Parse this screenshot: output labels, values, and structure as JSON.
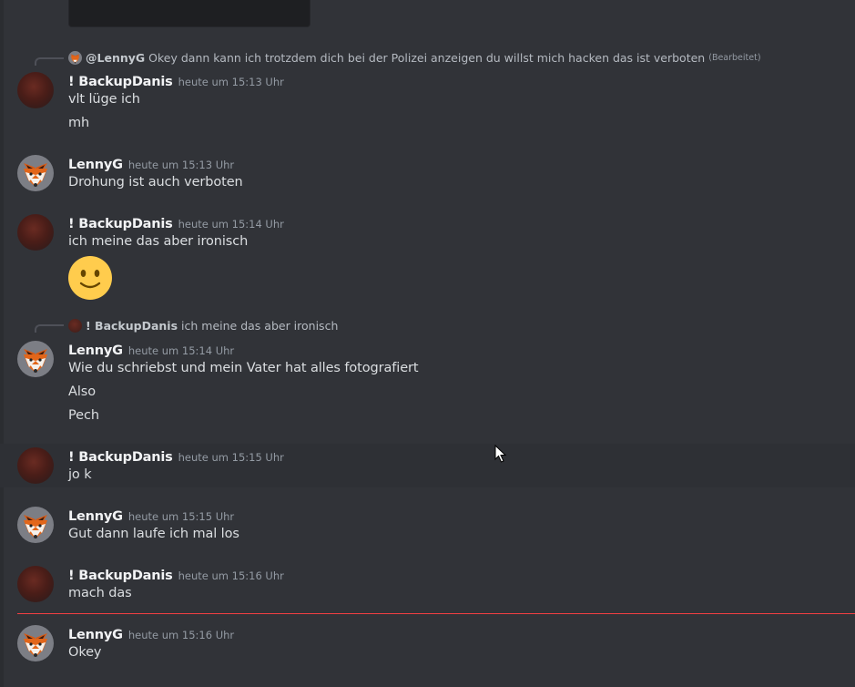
{
  "messages": {
    "m1": {
      "reply_to_name": "@LennyG",
      "reply_to_text": "Okey dann kann ich trotzdem dich bei der Polizei anzeigen du willst mich hacken das ist verboten",
      "reply_edited": "(Bearbeitet)",
      "author": "! BackupDanis",
      "time": "heute um 15:13 Uhr",
      "lines": [
        "vlt lüge ich",
        "mh"
      ]
    },
    "m2": {
      "author": "LennyG",
      "time": "heute um 15:13 Uhr",
      "lines": [
        "Drohung ist auch verboten"
      ]
    },
    "m3": {
      "author": "! BackupDanis",
      "time": "heute um 15:14 Uhr",
      "lines": [
        "ich meine das aber ironisch"
      ],
      "emoji": "slightly-smiling-face"
    },
    "m4": {
      "reply_to_name": "! BackupDanis",
      "reply_to_text": "ich meine das aber ironisch",
      "author": "LennyG",
      "time": "heute um 15:14 Uhr",
      "lines": [
        "Wie du schriebst und mein Vater hat alles fotografiert",
        "Also",
        "Pech"
      ]
    },
    "m5": {
      "author": "! BackupDanis",
      "time": "heute um 15:15 Uhr",
      "lines": [
        "jo k"
      ]
    },
    "m6": {
      "author": "LennyG",
      "time": "heute um 15:15 Uhr",
      "lines": [
        "Gut dann laufe ich mal los"
      ]
    },
    "m7": {
      "author": "! BackupDanis",
      "time": "heute um 15:16 Uhr",
      "lines": [
        "mach das"
      ]
    },
    "m8": {
      "author": "LennyG",
      "time": "heute um 15:16 Uhr",
      "lines": [
        "Okey"
      ]
    }
  },
  "colors": {
    "background": "#313338",
    "username": "#f2f3f5",
    "timestamp": "#949ba4",
    "new_messages_divider": "#f23f43"
  }
}
